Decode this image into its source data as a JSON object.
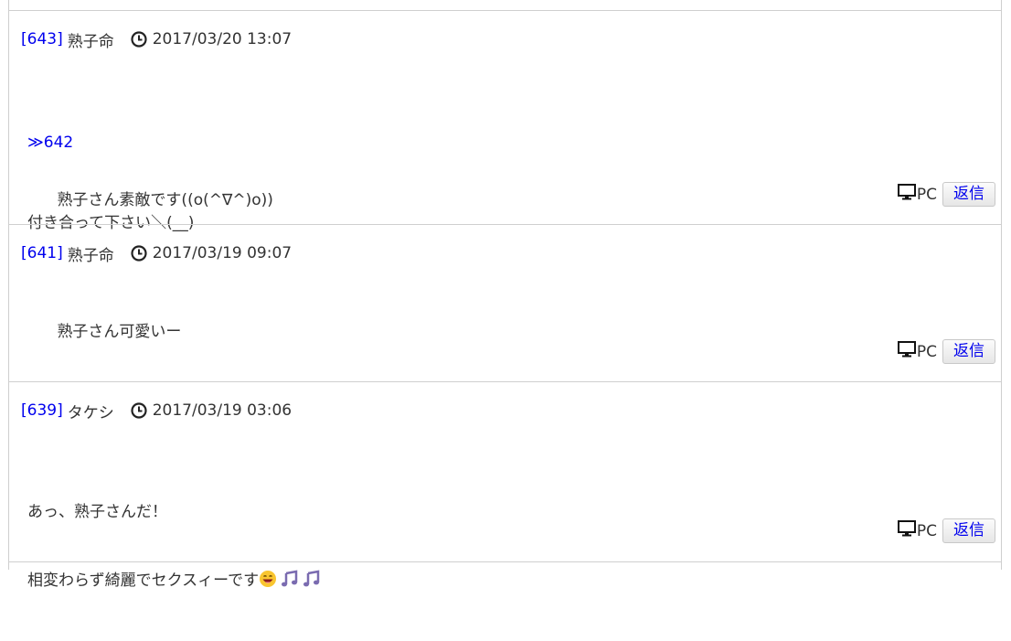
{
  "posts": [
    {
      "number": "[643]",
      "author": "熟子命",
      "date": "2017/03/20 13:07",
      "anchor": "≫642",
      "body": "熟子さん素敵です((o(^∇^)o))\n付き合って下さい＼(__)",
      "device": "PC",
      "reply_label": "返信"
    },
    {
      "number": "[641]",
      "author": "熟子命",
      "date": "2017/03/19 09:07",
      "body": "熟子さん可愛いー",
      "device": "PC",
      "reply_label": "返信"
    },
    {
      "number": "[639]",
      "author": "タケシ",
      "date": "2017/03/19 03:06",
      "body_line1": "あっ、熟子さんだ！",
      "body_line2": "相変わらず綺麗でセクスィーです",
      "emojis": [
        "grinning-face-icon",
        "music-note-icon",
        "music-note-icon"
      ],
      "device": "PC",
      "reply_label": "返信"
    }
  ]
}
